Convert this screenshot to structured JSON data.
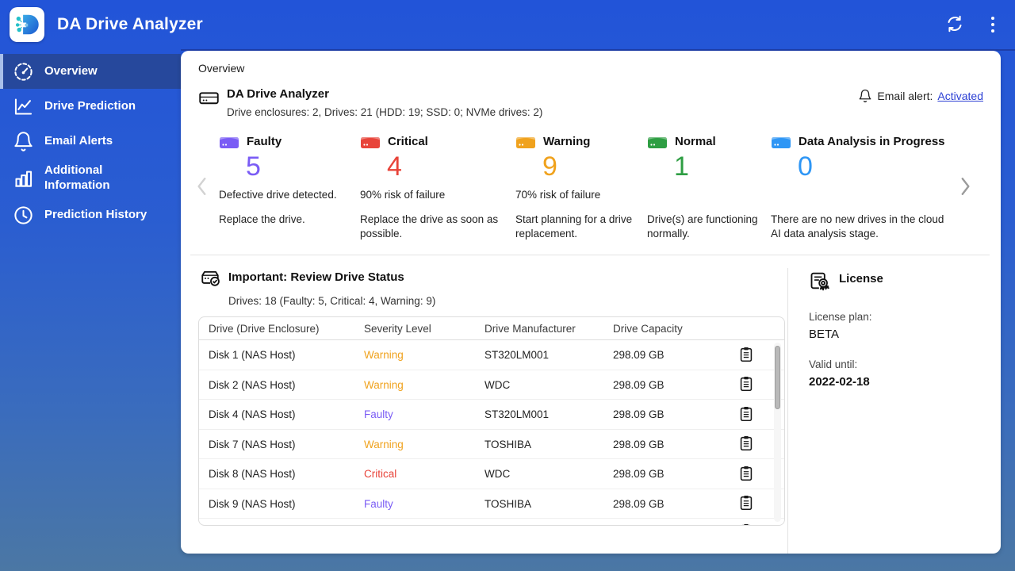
{
  "header": {
    "app_title": "DA Drive Analyzer",
    "icons": [
      "refresh",
      "kebab-menu"
    ]
  },
  "sidebar": {
    "items": [
      {
        "label": "Overview",
        "icon": "gauge"
      },
      {
        "label": "Drive Prediction",
        "icon": "chart-line"
      },
      {
        "label": "Email Alerts",
        "icon": "bell"
      },
      {
        "label": "Additional Information",
        "icon": "bar-chart"
      },
      {
        "label": "Prediction History",
        "icon": "clock"
      }
    ]
  },
  "main": {
    "tab_label": "Overview",
    "summary": {
      "title": "DA Drive Analyzer",
      "subtitle": "Drive enclosures: 2, Drives: 21 (HDD: 19; SSD: 0; NVMe drives: 2)"
    },
    "email_alert": {
      "label": "Email alert:",
      "status": "Activated"
    },
    "status_cards": [
      {
        "label": "Faulty",
        "count": "5",
        "color": "#7a5cf5",
        "line1": "Defective drive detected.",
        "line2": "Replace the drive."
      },
      {
        "label": "Critical",
        "count": "4",
        "color": "#e8443a",
        "line1": "90% risk of failure",
        "line2": "Replace the drive as soon as possible."
      },
      {
        "label": "Warning",
        "count": "9",
        "color": "#f0a21d",
        "line1": "70% risk of failure",
        "line2": "Start planning for a drive replacement."
      },
      {
        "label": "Normal",
        "count": "1",
        "color": "#2e9e43",
        "line1": "",
        "line2": "Drive(s) are functioning normally."
      },
      {
        "label": "Data Analysis in Progress",
        "count": "0",
        "color": "#2e96f5",
        "line1": "",
        "line2": "There are no new drives in the cloud AI data analysis stage."
      }
    ],
    "review": {
      "title": "Important: Review Drive Status",
      "subtitle": "Drives: 18 (Faulty: 5, Critical: 4, Warning: 9)"
    },
    "table": {
      "columns": [
        "Drive (Drive Enclosure)",
        "Severity Level",
        "Drive Manufacturer",
        "Drive Capacity"
      ],
      "rows": [
        {
          "drive": "Disk 1 (NAS Host)",
          "severity": "Warning",
          "manufacturer": "ST320LM001",
          "capacity": "298.09 GB"
        },
        {
          "drive": "Disk 2 (NAS Host)",
          "severity": "Warning",
          "manufacturer": "WDC",
          "capacity": "298.09 GB"
        },
        {
          "drive": "Disk 4 (NAS Host)",
          "severity": "Faulty",
          "manufacturer": "ST320LM001",
          "capacity": "298.09 GB"
        },
        {
          "drive": "Disk 7 (NAS Host)",
          "severity": "Warning",
          "manufacturer": "TOSHIBA",
          "capacity": "298.09 GB"
        },
        {
          "drive": "Disk 8 (NAS Host)",
          "severity": "Critical",
          "manufacturer": "WDC",
          "capacity": "298.09 GB"
        },
        {
          "drive": "Disk 9 (NAS Host)",
          "severity": "Faulty",
          "manufacturer": "TOSHIBA",
          "capacity": "298.09 GB"
        }
      ]
    },
    "license": {
      "title": "License",
      "plan_label": "License plan:",
      "plan": "BETA",
      "valid_label": "Valid until:",
      "valid": "2022-02-18"
    }
  },
  "severity_colors": {
    "Warning": "#f0a21d",
    "Faulty": "#7a5cf5",
    "Critical": "#e8443a"
  }
}
